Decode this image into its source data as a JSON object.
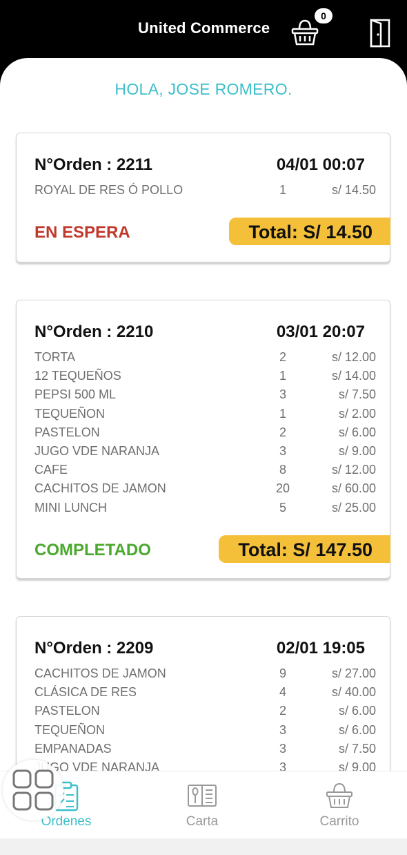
{
  "header": {
    "title": "United Commerce",
    "cart_count": "0"
  },
  "greeting": "HOLA, JOSE ROMERO.",
  "orders": [
    {
      "number": "N°Orden : 2211",
      "date": "04/01 00:07",
      "items": [
        {
          "name": "ROYAL DE RES Ó POLLO",
          "qty": "1",
          "price": "s/ 14.50"
        }
      ],
      "status": "EN ESPERA",
      "total": "Total: S/ 14.50"
    },
    {
      "number": "N°Orden : 2210",
      "date": "03/01 20:07",
      "items": [
        {
          "name": "TORTA",
          "qty": "2",
          "price": "s/ 12.00"
        },
        {
          "name": "12 TEQUEÑOS",
          "qty": "1",
          "price": "s/ 14.00"
        },
        {
          "name": "PEPSI 500 ML",
          "qty": "3",
          "price": "s/ 7.50"
        },
        {
          "name": "TEQUEÑON",
          "qty": "1",
          "price": "s/ 2.00"
        },
        {
          "name": "PASTELON",
          "qty": "2",
          "price": "s/ 6.00"
        },
        {
          "name": "JUGO VDE NARANJA",
          "qty": "3",
          "price": "s/ 9.00"
        },
        {
          "name": "CAFE",
          "qty": "8",
          "price": "s/ 12.00"
        },
        {
          "name": "CACHITOS DE JAMON",
          "qty": "20",
          "price": "s/ 60.00"
        },
        {
          "name": "MINI LUNCH",
          "qty": "5",
          "price": "s/ 25.00"
        }
      ],
      "status": "COMPLETADO",
      "total": "Total: S/ 147.50"
    },
    {
      "number": "N°Orden : 2209",
      "date": "02/01 19:05",
      "items": [
        {
          "name": "CACHITOS DE JAMON",
          "qty": "9",
          "price": "s/ 27.00"
        },
        {
          "name": "CLÁSICA DE RES",
          "qty": "4",
          "price": "s/ 40.00"
        },
        {
          "name": "PASTELON",
          "qty": "2",
          "price": "s/ 6.00"
        },
        {
          "name": "TEQUEÑON",
          "qty": "3",
          "price": "s/ 6.00"
        },
        {
          "name": "EMPANADAS",
          "qty": "3",
          "price": "s/ 7.50"
        },
        {
          "name": "JUGO VDE NARANJA",
          "qty": "3",
          "price": "s/ 9.00"
        }
      ]
    }
  ],
  "nav": {
    "ordenes": "Ordenes",
    "carta": "Carta",
    "carrito": "Carrito"
  },
  "colors": {
    "accent": "#3cbfca",
    "status_waiting": "#c0392b",
    "status_done": "#4aa82c",
    "total_bg": "#f4c03a"
  },
  "icons": {
    "cart": "basket-icon",
    "exit": "door-exit-icon",
    "ordenes": "clipboard-list-icon",
    "carta": "menu-book-icon",
    "carrito": "basket-icon",
    "floating": "grid-apps-icon"
  }
}
